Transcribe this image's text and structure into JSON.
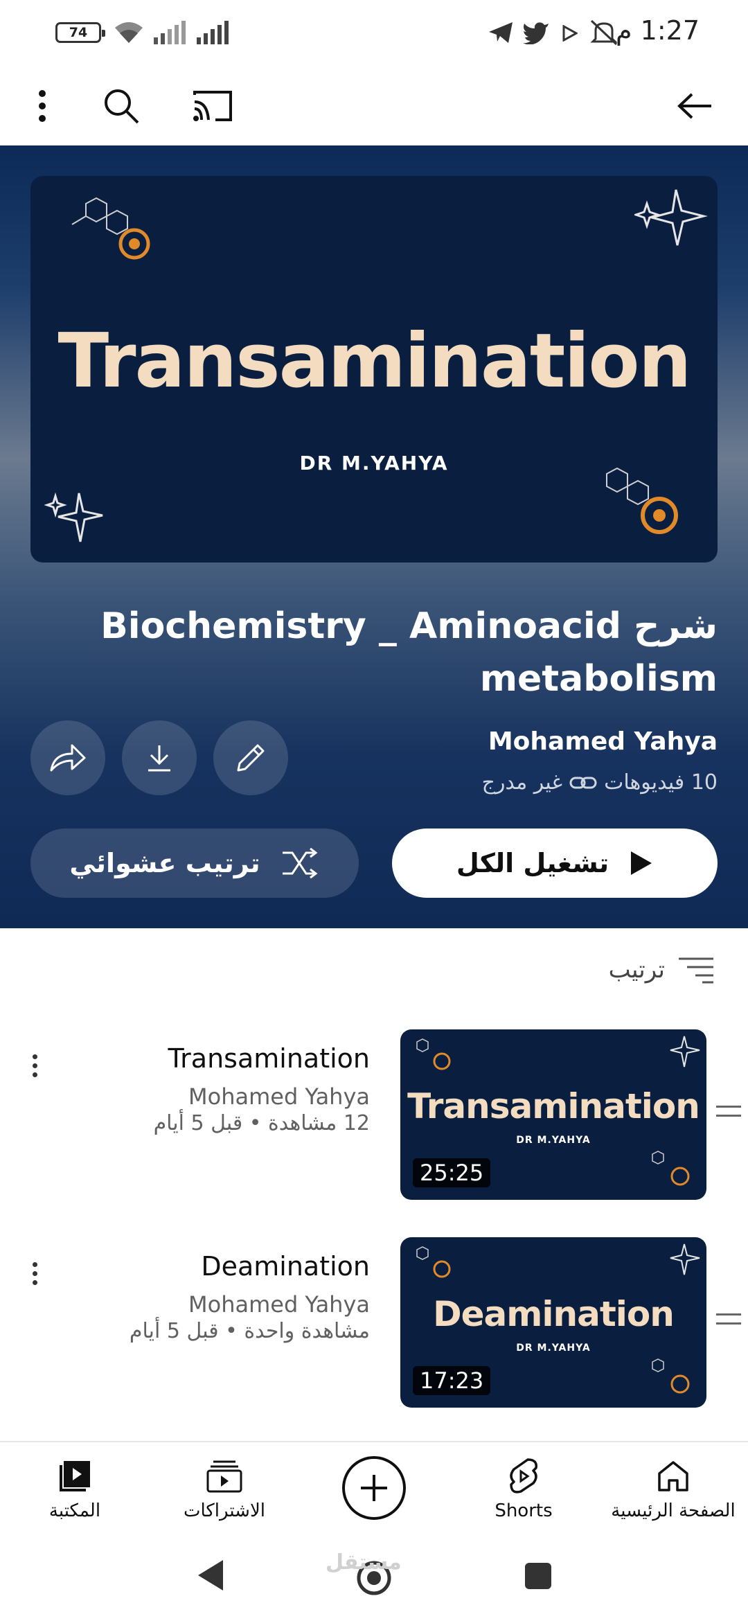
{
  "status_bar": {
    "battery": "74",
    "time": "1:27 م"
  },
  "banner": {
    "title": "Transamination",
    "subtitle": "DR M.YAHYA"
  },
  "playlist": {
    "title": "Biochemistry _ Aminoacid شرح metabolism",
    "owner": "Mohamed Yahya",
    "video_count": "10 فيديوهات",
    "visibility": "غير مدرج",
    "play_all_label": "تشغيل الكل",
    "shuffle_label": "ترتيب عشوائي"
  },
  "sort": {
    "label": "ترتيب"
  },
  "videos": [
    {
      "title": "Transamination",
      "channel": "Mohamed Yahya",
      "meta": "12 مشاهدة • قبل 5 أيام",
      "duration": "25:25",
      "thumb_title": "Transamination",
      "thumb_sub": "DR M.YAHYA"
    },
    {
      "title": "Deamination",
      "channel": "Mohamed Yahya",
      "meta": "مشاهدة واحدة • قبل 5 أيام",
      "duration": "17:23",
      "thumb_title": "Deamination",
      "thumb_sub": "DR M.YAHYA"
    }
  ],
  "bottom_nav": {
    "home": "الصفحة الرئيسية",
    "shorts": "Shorts",
    "subscriptions": "الاشتراكات",
    "library": "المكتبة"
  },
  "watermark": "مستقل"
}
